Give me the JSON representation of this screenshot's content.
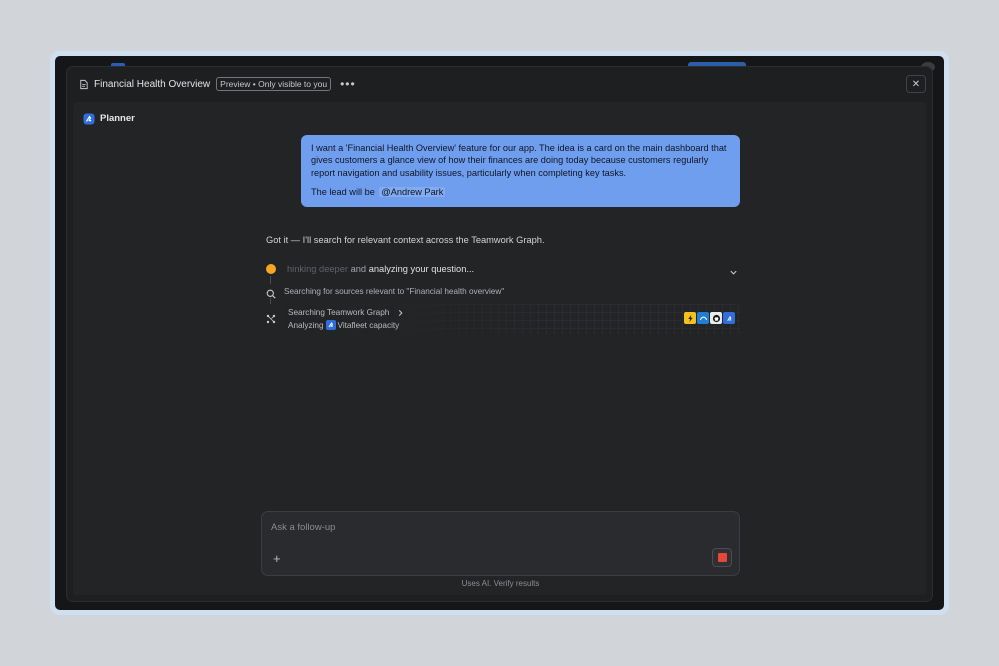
{
  "header": {
    "title": "Financial Health Overview",
    "badge": "Preview • Only visible to you",
    "more_glyph": "•••",
    "close_glyph": "✕"
  },
  "agent": {
    "name": "Planner"
  },
  "user_message": {
    "text": "I want a 'Financial Health Overview' feature for our app. The idea is a card on the main dashboard that gives customers a glance view of how their finances are doing today because customers regularly report navigation and usability issues, particularly when completing key tasks.",
    "lead_prefix": "The lead will be",
    "mention": "@Andrew Park"
  },
  "ai_reply": "Got it — I'll search for relevant context across the Teamwork Graph.",
  "thinking": {
    "part_dim": "hinking deeper",
    "part_mid": " and ",
    "part_bright": "analyzing your question..."
  },
  "search_step": "Searching for sources relevant to \"Financial health overview\"",
  "graph_step": {
    "title": "Searching Teamwork Graph",
    "sub_prefix": "Analyzing",
    "sub_item": "Vitafleet capacity",
    "tools": [
      "zap-icon",
      "sky-icon",
      "github-icon",
      "jira-icon"
    ]
  },
  "composer": {
    "placeholder": "Ask a follow-up",
    "plus_glyph": "+"
  },
  "footer": "Uses AI. Verify results",
  "colors": {
    "accent_blue": "#6f9eef",
    "status_orange": "#f5a623",
    "stop_red": "#e5473b"
  }
}
